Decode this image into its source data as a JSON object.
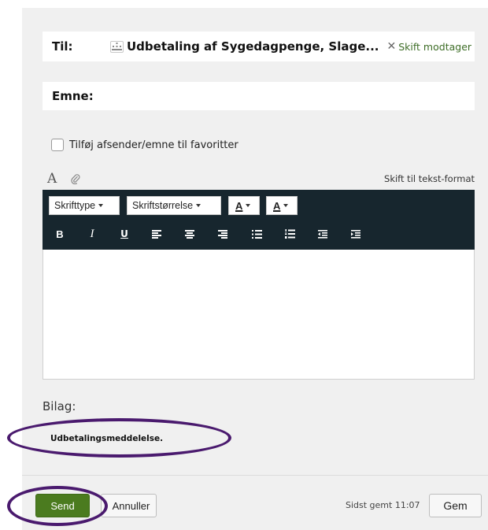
{
  "to": {
    "label": "Til:",
    "recipient": "Udbetaling af Sygedagpenge, Slage...",
    "change_label": "Skift modtager",
    "icon": "organization-icon"
  },
  "subject": {
    "label": "Emne:",
    "value": ""
  },
  "favorite": {
    "label": "Tilføj afsender/emne til favoritter",
    "checked": false
  },
  "editor_header": {
    "switch_label": "Skift til tekst-format"
  },
  "toolbar": {
    "font_label": "Skrifttype",
    "size_label": "Skriftstørrelse",
    "text_color_label": "A",
    "bg_color_label": "A",
    "bold": "B",
    "italic": "I",
    "underline": "U"
  },
  "editor": {
    "content": ""
  },
  "attachments": {
    "label": "Bilag:",
    "items": [
      "Udbetalingsmeddelelse."
    ]
  },
  "footer": {
    "send_label": "Send",
    "cancel_label": "Annuller",
    "saved_text": "Sidst gemt 11:07",
    "save_label": "Gem"
  },
  "colors": {
    "send_green": "#4b7b1f",
    "toolbar_bg": "#17262e",
    "link_green": "#3f6e28",
    "annotation_purple": "#4a1a6e"
  }
}
